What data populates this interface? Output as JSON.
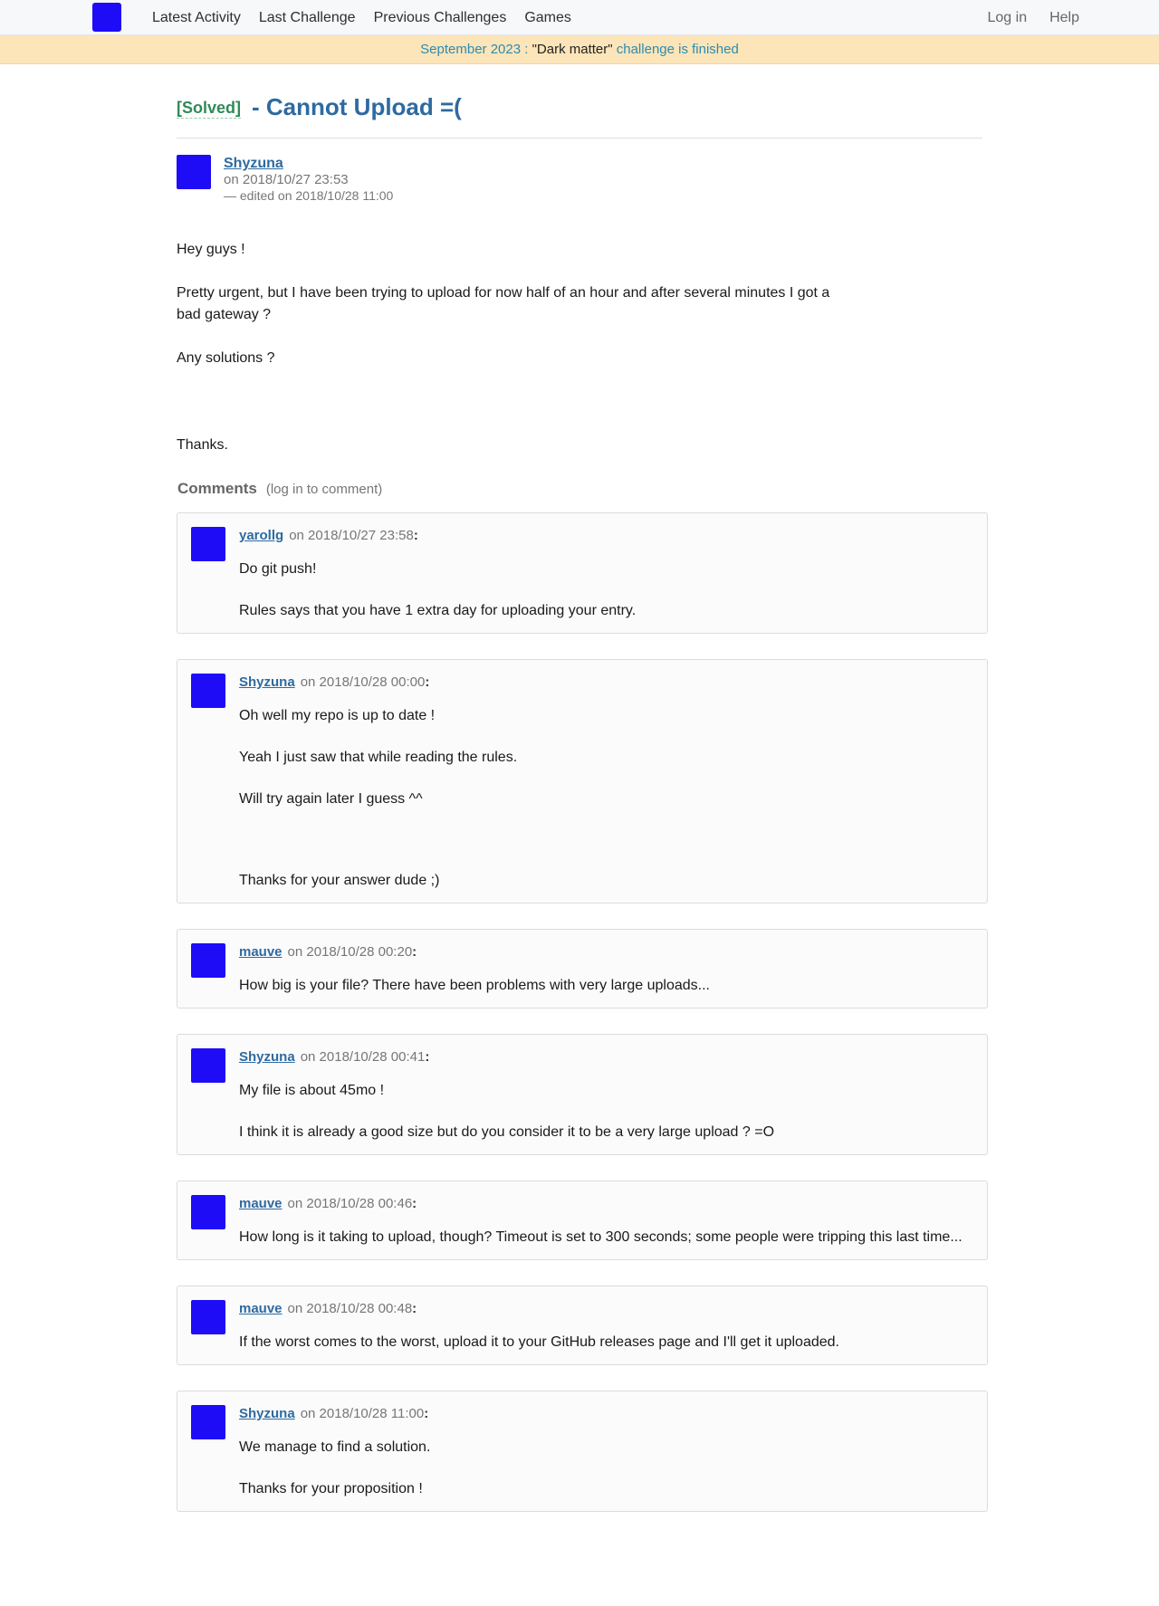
{
  "nav": {
    "links": [
      "Latest Activity",
      "Last Challenge",
      "Previous Challenges",
      "Games"
    ],
    "right_links": [
      "Log in",
      "Help"
    ]
  },
  "banner": {
    "date": "September 2023 :",
    "challenge": "\"Dark matter\"",
    "status": "challenge is finished"
  },
  "post": {
    "solved_tag": "[Solved]",
    "title": "- Cannot Upload =(",
    "author": "Shyzuna",
    "date": "on 2018/10/27 23:53",
    "edited": "— edited on 2018/10/28 11:00",
    "body": [
      "Hey guys !",
      "Pretty urgent, but I have been trying to upload for now half of an hour and after several minutes I got a bad gateway ?",
      "Any solutions ?",
      "Thanks."
    ]
  },
  "comments_section": {
    "title": "Comments",
    "hint": "(log in to comment)"
  },
  "comments": [
    {
      "user": "yarollg",
      "date": "on 2018/10/27 23:58",
      "body": [
        "Do git push!",
        "Rules says that you have 1 extra day for uploading your entry."
      ]
    },
    {
      "user": "Shyzuna",
      "date": "on 2018/10/28 00:00",
      "body": [
        "Oh well my repo is up to date !",
        "Yeah I just saw that while reading the rules.",
        "Will try again later I guess ^^",
        "Thanks for your answer dude ;)"
      ]
    },
    {
      "user": "mauve",
      "date": "on 2018/10/28 00:20",
      "body": [
        "How big is your file? There have been problems with very large uploads..."
      ]
    },
    {
      "user": "Shyzuna",
      "date": "on 2018/10/28 00:41",
      "body": [
        "My file is about 45mo !",
        "I think it is already a good size but do you consider it to be a very large upload ? =O"
      ]
    },
    {
      "user": "mauve",
      "date": "on 2018/10/28 00:46",
      "body": [
        "How long is it taking to upload, though? Timeout is set to 300 seconds; some people were tripping this last time..."
      ]
    },
    {
      "user": "mauve",
      "date": "on 2018/10/28 00:48",
      "body": [
        "If the worst comes to the worst, upload it to your GitHub releases page and I'll get it uploaded."
      ]
    },
    {
      "user": "Shyzuna",
      "date": "on 2018/10/28 11:00",
      "body": [
        "We manage to find a solution.",
        "Thanks for your proposition !"
      ]
    }
  ]
}
